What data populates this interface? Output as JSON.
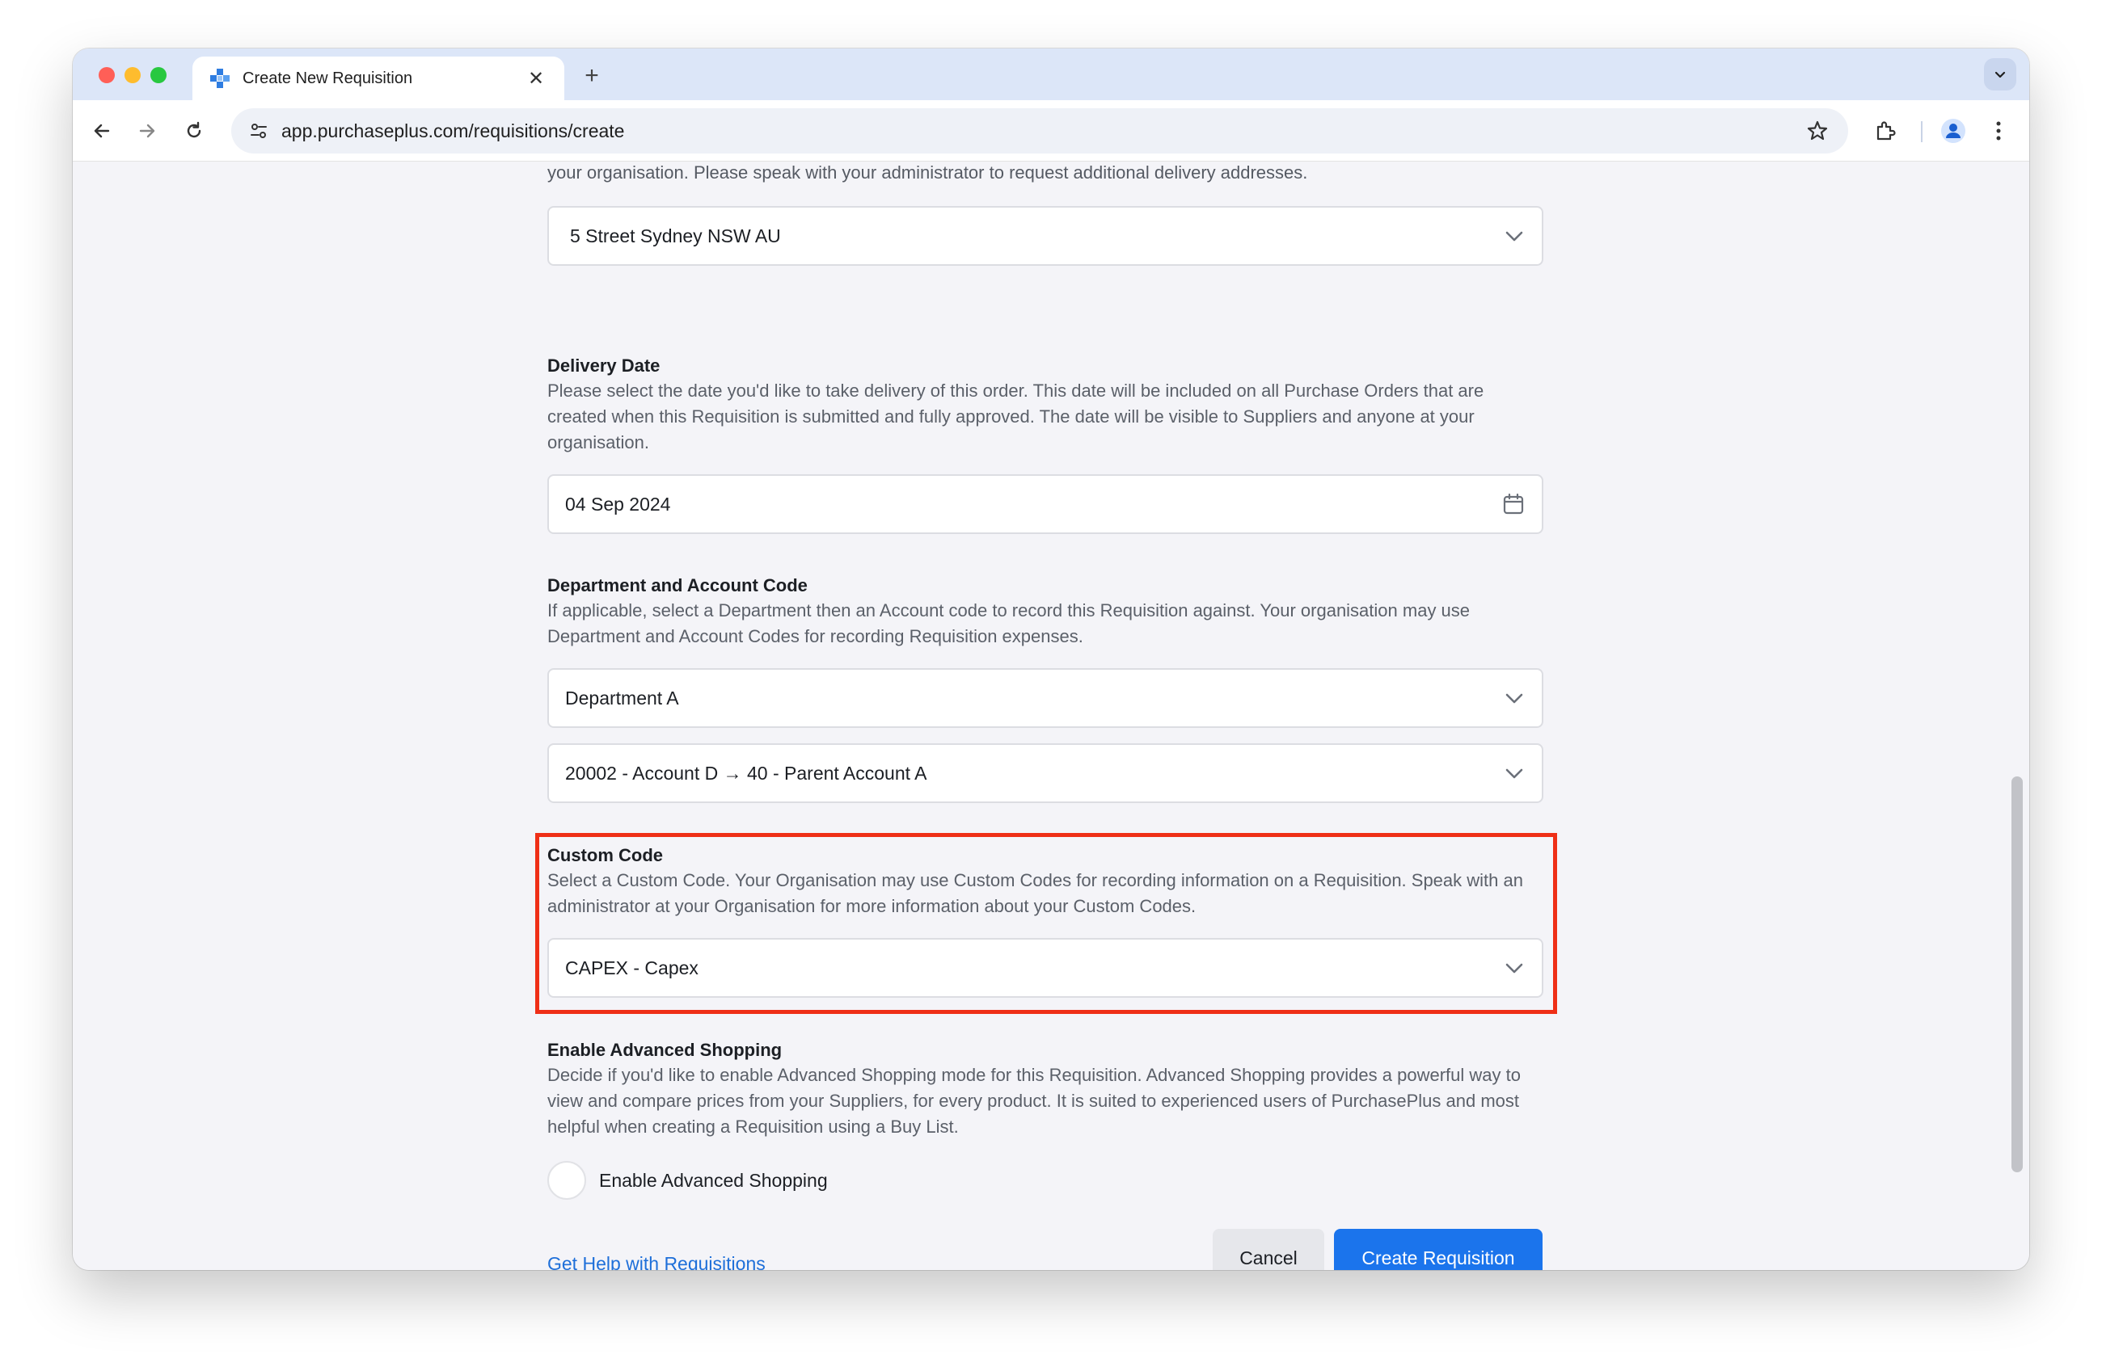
{
  "browser": {
    "tab_title": "Create New Requisition",
    "tab_close": "✕",
    "new_tab": "+",
    "url": "app.purchaseplus.com/requisitions/create"
  },
  "form": {
    "delivery_address_desc_tail": "your organisation. Please speak with your administrator to request additional delivery addresses.",
    "delivery_address_value": "5 Street  Sydney NSW AU",
    "delivery_date": {
      "label": "Delivery Date",
      "desc": "Please select the date you'd like to take delivery of this order. This date will be included on all Purchase Orders that are created when this Requisition is submitted and fully approved. The date will be visible to Suppliers and anyone at your organisation.",
      "value": "04 Sep 2024"
    },
    "department": {
      "label": "Department and Account Code",
      "desc": "If applicable, select a Department then an Account code to record this Requisition against. Your organisation may use Department and Account Codes for recording Requisition expenses.",
      "department_value": "Department A",
      "account_value": "20002 - Account D → 40 - Parent Account A"
    },
    "custom_code": {
      "label": "Custom Code",
      "desc": "Select a Custom Code. Your Organisation may use Custom Codes for recording information on a Requisition. Speak with an administrator at your Organisation for more information about your Custom Codes.",
      "value": "CAPEX - Capex"
    },
    "advanced_shopping": {
      "label": "Enable Advanced Shopping",
      "desc": "Decide if you'd like to enable Advanced Shopping mode for this Requisition. Advanced Shopping provides a powerful way to view and compare prices from your Suppliers, for every product. It is suited to experienced users of PurchasePlus and most helpful when creating a Requisition using a Buy List.",
      "toggle_label": "Enable Advanced Shopping",
      "enabled": false
    },
    "help_link": "Get Help with Requisitions",
    "cancel_label": "Cancel",
    "create_label": "Create Requisition"
  },
  "colors": {
    "primary": "#1b74ec",
    "highlight": "#ef2f17",
    "link": "#1e6fd9"
  }
}
